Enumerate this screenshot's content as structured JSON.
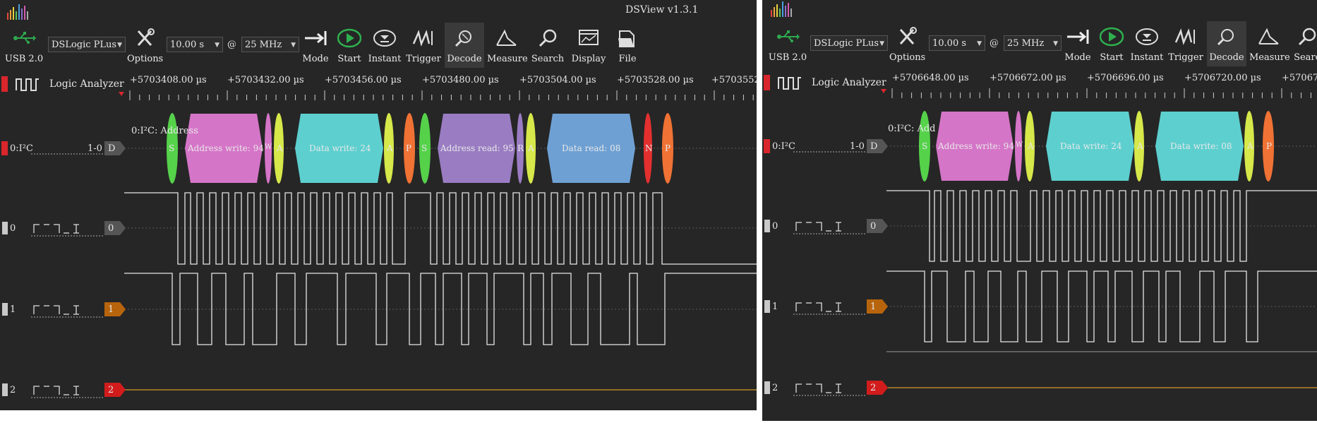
{
  "colors": {
    "background": "#262626",
    "address": "#d575c8",
    "data_write": "#5dcfcf",
    "address_read": "#9a7cc3",
    "data_read": "#6ea0d3",
    "start": "#55d24a",
    "ack": "#d6e84a",
    "stop": "#f07234",
    "nack": "#e3302f",
    "rw": "#d575c8",
    "ch1_tag": "#b8640c",
    "ch2_tag": "#d21c1c",
    "ch2_line": "#b5862a"
  },
  "left": {
    "title": "DSView v1.3.1",
    "toolbar": {
      "usb_label": "USB 2.0",
      "device": "DSLogic PLus",
      "options_label": "Options",
      "duration": "10.00 s",
      "at": "@",
      "rate": "25 MHz",
      "mode_label": "Mode",
      "start_label": "Start",
      "instant_label": "Instant",
      "trigger_label": "Trigger",
      "decode_label": "Decode",
      "measure_label": "Measure",
      "search_label": "Search",
      "display_label": "Display",
      "file_label": "File"
    },
    "logic_analyzer": "Logic Analyzer",
    "ruler": [
      "+5703408.00 µs",
      "+5703432.00 µs",
      "+5703456.00 µs",
      "+5703480.00 µs",
      "+5703504.00 µs",
      "+5703528.00 µs",
      "+5703552.0"
    ],
    "decoder_title": "0:I²C: Address",
    "decoder_channel": "0:I²C",
    "decoder_range": "1-0",
    "decoder_tag": "D",
    "channels": [
      {
        "num": "0",
        "tag": "0"
      },
      {
        "num": "1",
        "tag": "1"
      },
      {
        "num": "2",
        "tag": "2"
      }
    ],
    "protocol": {
      "start": "S",
      "address_write": "Address write: 94",
      "write_bit": "W",
      "ack": "A",
      "data_write": "Data write: 24",
      "stop": "P",
      "address_read": "Address read: 95",
      "read_bit": "R",
      "data_read": "Data read: 08",
      "nack": "N"
    }
  },
  "right": {
    "toolbar": {
      "usb_label": "USB 2.0",
      "device": "DSLogic PLus",
      "options_label": "Options",
      "duration": "10.00 s",
      "at": "@",
      "rate": "25 MHz",
      "mode_label": "Mode",
      "start_label": "Start",
      "instant_label": "Instant",
      "trigger_label": "Trigger",
      "decode_label": "Decode",
      "measure_label": "Measure",
      "search_label": "Searc"
    },
    "logic_analyzer": "Logic Analyzer",
    "ruler": [
      "+5706648.00 µs",
      "+5706672.00 µs",
      "+5706696.00 µs",
      "+5706720.00 µs",
      "+570674"
    ],
    "decoder_title": "0:I²C: Add",
    "decoder_channel": "0:I²C",
    "decoder_range": "1-0",
    "decoder_tag": "D",
    "channels": [
      {
        "num": "0",
        "tag": "0"
      },
      {
        "num": "1",
        "tag": "1"
      },
      {
        "num": "2",
        "tag": "2"
      }
    ],
    "protocol": {
      "start": "S",
      "address_write": "Address write: 94",
      "write_bit": "W",
      "ack": "A",
      "data_write": "Data write: 24",
      "data_write2": "Data write: 08",
      "stop": "P"
    }
  }
}
